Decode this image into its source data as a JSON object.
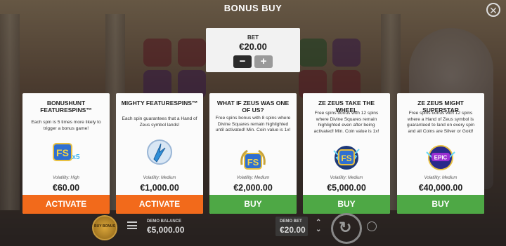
{
  "header": {
    "title": "BONUS BUY"
  },
  "bet": {
    "label": "BET",
    "value": "€20.00",
    "minus": "−",
    "plus": "+"
  },
  "cards": [
    {
      "title": "BONUSHUNT FEATURESPINS™",
      "description": "Each spin is 5 times more likely to trigger a bonus game!",
      "volatility": "Volatility: High",
      "price": "€60.00",
      "button": "ACTIVATE",
      "button_color": "#f26a1b",
      "icon": "fs-x5-icon"
    },
    {
      "title": "MIGHTY FEATURESPINS™",
      "description": "Each spin guarantees that a Hand of Zeus symbol lands!",
      "volatility": "Volatility: Medium",
      "price": "€1,000.00",
      "button": "ACTIVATE",
      "button_color": "#f26a1b",
      "icon": "hand-of-zeus-icon"
    },
    {
      "title": "WHAT IF ZEUS WAS ONE OF US?",
      "description": "Free spins bonus with 8 spins where Divine Squares remain highlighted until activated! Min. Coin value is 1x!",
      "volatility": "Volatility: Medium",
      "price": "€2,000.00",
      "button": "BUY",
      "button_color": "#4ea845",
      "icon": "fs-laurel-icon"
    },
    {
      "title": "ZE ZEUS TAKE THE WHEEL",
      "description": "Free spins bonus with 12 spins where Divine Squares remain highlighted even after being activated! Min. Coin value is 1x!",
      "volatility": "Volatility: Medium",
      "price": "€5,000.00",
      "button": "BUY",
      "button_color": "#4ea845",
      "icon": "fs-lightning-icon"
    },
    {
      "title": "ZE ZEUS MIGHT SUPERSTAR",
      "description": "Free spins bonus with 12 spins where a Hand of Zeus symbol is guaranteed to land on every spin and all Coins are Silver or Gold!",
      "volatility": "Volatility: Medium",
      "price": "€40,000.00",
      "button": "BUY",
      "button_color": "#4ea845",
      "icon": "epic-icon"
    }
  ],
  "footer": {
    "bonus_button": "BUY BONUS",
    "balance_label": "DEMO BALANCE",
    "balance_value": "€5,000.00",
    "bet_label": "DEMO BET",
    "bet_value": "€20.00"
  }
}
